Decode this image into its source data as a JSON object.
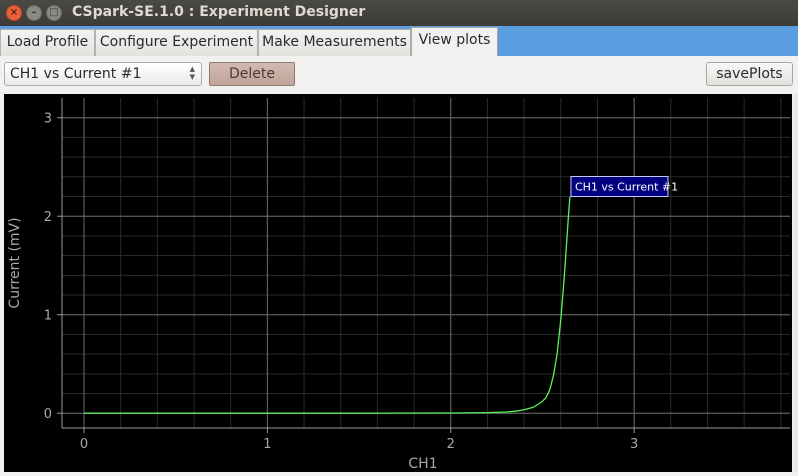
{
  "window": {
    "title": "CSpark-SE.1.0 : Experiment Designer",
    "close_glyph": "×",
    "minimize_glyph": "–",
    "maximize_glyph": "□"
  },
  "tabs": [
    {
      "label": "Load Profile",
      "active": false
    },
    {
      "label": "Configure Experiment",
      "active": false
    },
    {
      "label": "Make Measurements",
      "active": false
    },
    {
      "label": "View plots",
      "active": true
    }
  ],
  "toolbar": {
    "plot_select_value": "CH1 vs Current #1",
    "delete_label": "Delete",
    "save_label": "savePlots"
  },
  "colors": {
    "tab_bar": "#5b9ee0",
    "plot_background": "#000000",
    "curve": "#5bf25b",
    "legend_background": "#000080"
  },
  "chart_data": {
    "type": "line",
    "xlabel": "CH1",
    "ylabel": "Current (mV)",
    "xlim": [
      -0.12,
      3.85
    ],
    "ylim": [
      -0.15,
      3.2
    ],
    "xticks": [
      0,
      1,
      2,
      3
    ],
    "yticks": [
      0,
      1,
      2,
      3
    ],
    "x_minor_step": 0.2,
    "y_minor_step": 0.2,
    "grid": true,
    "legend": "CH1 vs Current #1",
    "series": [
      {
        "name": "CH1 vs Current #1",
        "x": [
          0,
          0.5,
          1.0,
          1.5,
          2.0,
          2.2,
          2.3,
          2.35,
          2.4,
          2.45,
          2.5,
          2.52,
          2.54,
          2.56,
          2.58,
          2.6,
          2.62,
          2.64,
          2.65
        ],
        "y": [
          0,
          0,
          0,
          0,
          0.002,
          0.006,
          0.012,
          0.02,
          0.035,
          0.06,
          0.12,
          0.16,
          0.24,
          0.38,
          0.6,
          0.95,
          1.4,
          1.95,
          2.2
        ]
      }
    ]
  }
}
